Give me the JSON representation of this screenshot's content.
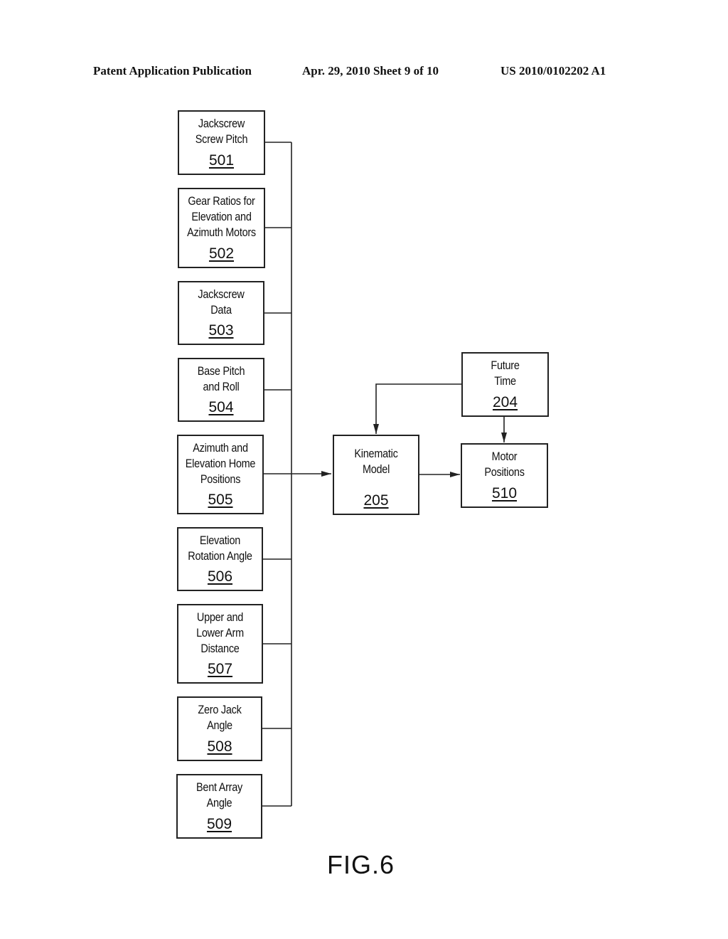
{
  "header": {
    "publication": "Patent Application Publication",
    "date_sheet": "Apr. 29, 2010  Sheet 9 of 10",
    "patent_number": "US 2010/0102202 A1"
  },
  "inputs": [
    {
      "label": "Jackscrew\nScrew Pitch",
      "ref": "501"
    },
    {
      "label": "Gear Ratios for\nElevation and\nAzimuth Motors",
      "ref": "502"
    },
    {
      "label": "Jackscrew\nData",
      "ref": "503"
    },
    {
      "label": "Base Pitch\nand Roll",
      "ref": "504"
    },
    {
      "label": "Azimuth and\nElevation Home\nPositions",
      "ref": "505"
    },
    {
      "label": "Elevation\nRotation Angle",
      "ref": "506"
    },
    {
      "label": "Upper and\nLower Arm\nDistance",
      "ref": "507"
    },
    {
      "label": "Zero Jack\nAngle",
      "ref": "508"
    },
    {
      "label": "Bent Array\nAngle",
      "ref": "509"
    }
  ],
  "kinematic_model": {
    "label": "Kinematic\nModel",
    "ref": "205"
  },
  "future_time": {
    "label": "Future\nTime",
    "ref": "204"
  },
  "motor_positions": {
    "label": "Motor\nPositions",
    "ref": "510"
  },
  "connections": [
    {
      "from": "inputs",
      "to": "205"
    },
    {
      "from": "204",
      "to": "205"
    },
    {
      "from": "204",
      "to": "510"
    },
    {
      "from": "205",
      "to": "510"
    }
  ],
  "figure_label": "FIG.6"
}
